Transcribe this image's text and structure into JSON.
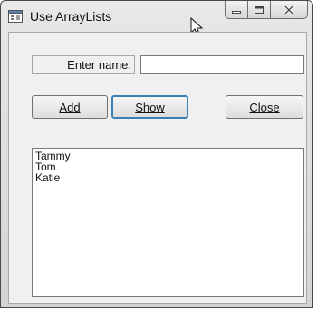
{
  "window": {
    "title": "Use ArrayLists"
  },
  "form": {
    "name_label": "Enter name:",
    "name_value": "",
    "buttons": {
      "add": "Add",
      "show": "Show",
      "close": "Close"
    },
    "list_items": [
      "Tammy",
      "Tom",
      "Katie"
    ]
  },
  "icons": {
    "app": "window-app-icon",
    "minimize": "minimize-icon",
    "maximize": "maximize-icon",
    "close": "close-icon",
    "cursor": "mouse-pointer-icon"
  }
}
